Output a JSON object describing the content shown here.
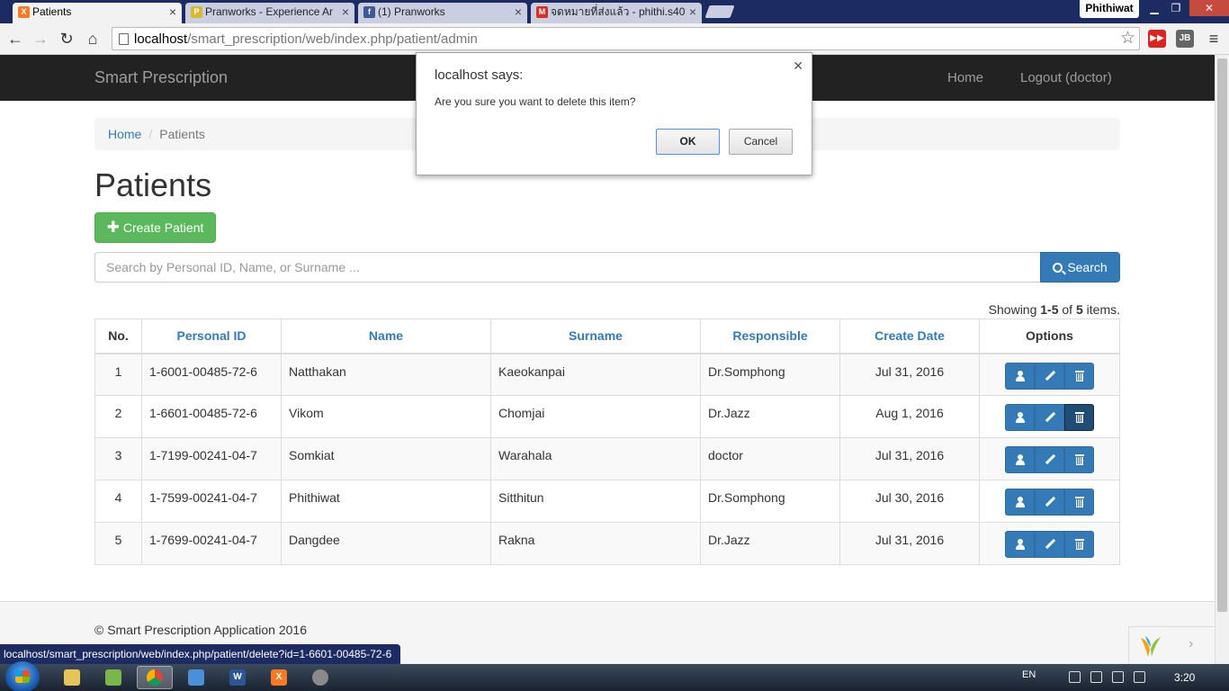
{
  "browser": {
    "tabs": [
      {
        "title": "Patients",
        "active": true
      },
      {
        "title": "Pranworks - Experience Ar",
        "active": false
      },
      {
        "title": "(1) Pranworks",
        "active": false
      },
      {
        "title": "จดหมายที่ส่งแล้ว - phithi.s40",
        "active": false
      }
    ],
    "profile_name": "Phithiwat",
    "url_host": "localhost",
    "url_path": "/smart_prescription/web/index.php/patient/admin",
    "status_url": "localhost/smart_prescription/web/index.php/patient/delete?id=1-6601-00485-72-6",
    "extension_jb": "JB"
  },
  "navbar": {
    "brand": "Smart Prescription",
    "links": [
      "Home",
      "Logout (doctor)"
    ]
  },
  "breadcrumb": {
    "home": "Home",
    "current": "Patients"
  },
  "page": {
    "title": "Patients",
    "create_label": "Create Patient",
    "search_placeholder": "Search by Personal ID, Name, or Surname ...",
    "search_label": "Search"
  },
  "summary": {
    "prefix": "Showing ",
    "range": "1-5",
    "middle": " of ",
    "total": "5",
    "suffix": " items."
  },
  "table": {
    "headers": [
      "No.",
      "Personal ID",
      "Name",
      "Surname",
      "Responsible",
      "Create Date",
      "Options"
    ],
    "rows": [
      {
        "no": "1",
        "personal_id": "1-6001-00485-72-6",
        "name": "Natthakan",
        "surname": "Kaeokanpai",
        "responsible": "Dr.Somphong",
        "create_date": "Jul 31, 2016"
      },
      {
        "no": "2",
        "personal_id": "1-6601-00485-72-6",
        "name": "Vikom",
        "surname": "Chomjai",
        "responsible": "Dr.Jazz",
        "create_date": "Aug 1, 2016"
      },
      {
        "no": "3",
        "personal_id": "1-7199-00241-04-7",
        "name": "Somkiat",
        "surname": "Warahala",
        "responsible": "doctor",
        "create_date": "Jul 31, 2016"
      },
      {
        "no": "4",
        "personal_id": "1-7599-00241-04-7",
        "name": "Phithiwat",
        "surname": "Sitthitun",
        "responsible": "Dr.Somphong",
        "create_date": "Jul 30, 2016"
      },
      {
        "no": "5",
        "personal_id": "1-7699-00241-04-7",
        "name": "Dangdee",
        "surname": "Rakna",
        "responsible": "Dr.Jazz",
        "create_date": "Jul 31, 2016"
      }
    ]
  },
  "footer": {
    "copyright": "© Smart Prescription Application 2016"
  },
  "dialog": {
    "title": "localhost says:",
    "message": "Are you sure you want to delete this item?",
    "ok": "OK",
    "cancel": "Cancel"
  },
  "taskbar": {
    "language": "EN",
    "time": "3:20"
  }
}
